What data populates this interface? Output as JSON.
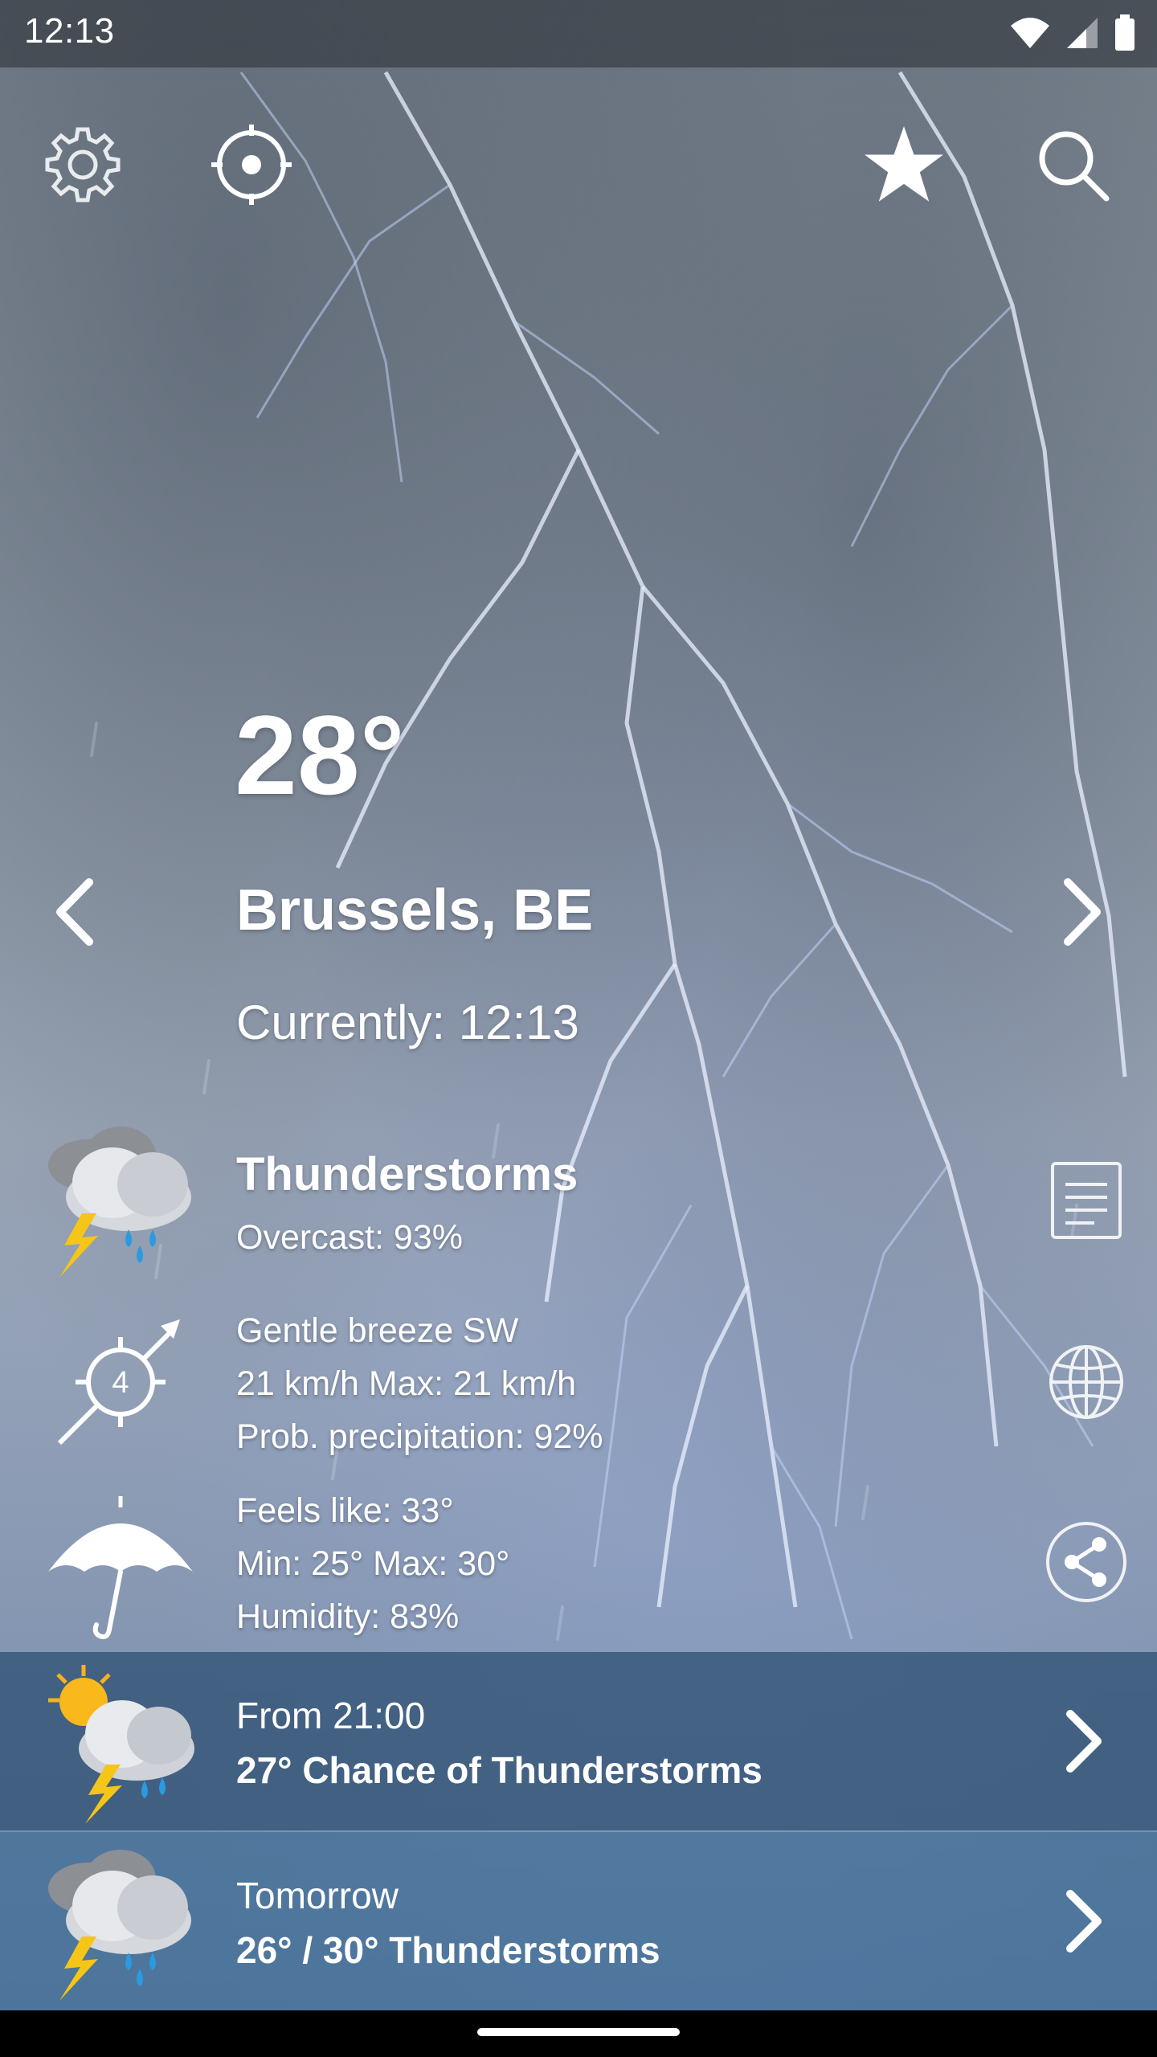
{
  "status_bar": {
    "time": "12:13"
  },
  "toolbar": {
    "settings_icon": "gear-icon",
    "location_icon": "locate-icon",
    "favorite_icon": "star-icon",
    "search_icon": "search-icon"
  },
  "current": {
    "temperature": "28°",
    "city": "Brussels, BE",
    "currently": "Currently: 12:13",
    "condition": "Thunderstorms",
    "overcast": "Overcast: 93%",
    "wind_desc": "Gentle breeze SW",
    "wind_speed": "21 km/h Max: 21 km/h",
    "precip": "Prob. precipitation: 92%",
    "feels_like": "Feels like: 33°",
    "min_max": "Min: 25° Max: 30°",
    "humidity": "Humidity: 83%",
    "wind_force": "4"
  },
  "forecast": [
    {
      "line1": "From 21:00",
      "line2": "27° Chance of Thunderstorms"
    },
    {
      "line1": "Tomorrow",
      "line2": "26° / 30° Thunderstorms"
    }
  ],
  "colors": {
    "row1_bg": "#345678",
    "row2_bg": "#406e96"
  }
}
